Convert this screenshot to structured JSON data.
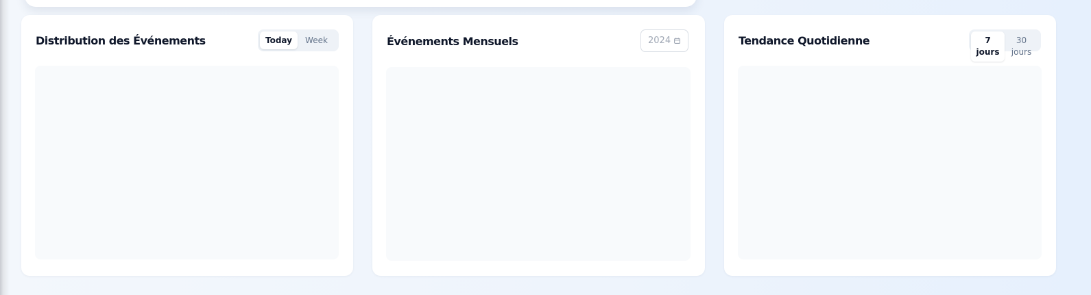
{
  "cards": [
    {
      "title": "Distribution des Événements",
      "toggle": {
        "options": [
          {
            "label": "Today",
            "active": true
          },
          {
            "label": "Week",
            "active": false
          }
        ]
      }
    },
    {
      "title": "Événements Mensuels",
      "year_picker": {
        "value": "2024",
        "icon": "calendar-icon"
      }
    },
    {
      "title": "Tendance Quotidienne",
      "toggle": {
        "options": [
          {
            "label_line1": "7",
            "label_line2": "jours",
            "active": true
          },
          {
            "label_line1": "30",
            "label_line2": "jours",
            "active": false
          }
        ]
      }
    }
  ],
  "colors": {
    "title": "#0f172a",
    "muted": "#64748b",
    "chart_bg": "#f8fafc",
    "toggle_bg": "#eef2f7"
  }
}
